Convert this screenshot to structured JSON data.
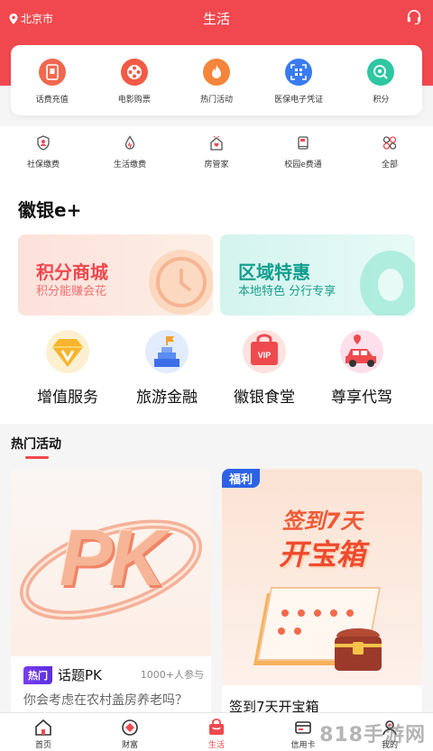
{
  "header": {
    "location": "北京市",
    "title": "生活",
    "support_icon": "headset-icon"
  },
  "services": [
    {
      "label": "话费充值",
      "icon": "phone-icon",
      "color": "#f0684e"
    },
    {
      "label": "电影购票",
      "icon": "film-reel-icon",
      "color": "#f25a45"
    },
    {
      "label": "热门活动",
      "icon": "flame-icon",
      "color": "#f4853a"
    },
    {
      "label": "医保电子凭证",
      "icon": "qr-scan-icon",
      "color": "#3a7bf2"
    },
    {
      "label": "积分",
      "icon": "points-icon",
      "color": "#2fc7a2"
    }
  ],
  "quick": [
    {
      "label": "社保缴费",
      "icon": "shield-person-icon"
    },
    {
      "label": "生活缴费",
      "icon": "drop-icon"
    },
    {
      "label": "房管家",
      "icon": "house-heart-icon"
    },
    {
      "label": "校园e费通",
      "icon": "book-icon"
    },
    {
      "label": "全部",
      "icon": "grid-icon"
    }
  ],
  "section_title": "徽银e+",
  "promos": [
    {
      "title": "积分商城",
      "subtitle": "积分能赚会花",
      "title_color": "#f0484e",
      "sub_color": "#f07070",
      "bg_from": "#fde1db",
      "bg_to": "#fcefe5"
    },
    {
      "title": "区域特惠",
      "subtitle": "本地特色 分行专享",
      "title_color": "#0f9e8e",
      "sub_color": "#1a9e8e",
      "bg_from": "#d4f4ee",
      "bg_to": "#e7faf6"
    }
  ],
  "features": [
    {
      "label": "增值服务",
      "icon": "diamond-v-icon"
    },
    {
      "label": "旅游金融",
      "icon": "flag-tower-icon"
    },
    {
      "label": "徽银食堂",
      "icon": "vip-bag-icon"
    },
    {
      "label": "尊享代驾",
      "icon": "red-car-icon"
    }
  ],
  "hot": {
    "title": "热门活动",
    "left": {
      "art_text": "PK",
      "badge": "热门",
      "title": "话题PK",
      "count": "1000+人参与",
      "question": "你会考虑在农村盖房养老吗？"
    },
    "right": {
      "tag": "福利",
      "art_line1": "签到7天",
      "art_line2": "开宝箱",
      "title": "签到7天开宝箱"
    }
  },
  "tabs": [
    {
      "label": "首页",
      "icon": "home-icon",
      "active": false
    },
    {
      "label": "财富",
      "icon": "wealth-icon",
      "active": false
    },
    {
      "label": "生活",
      "icon": "shopping-bag-icon",
      "active": true
    },
    {
      "label": "信用卡",
      "icon": "credit-card-icon",
      "active": false
    },
    {
      "label": "我的",
      "icon": "user-icon",
      "active": false
    }
  ],
  "watermark": "818手游网",
  "colors": {
    "brand": "#f0484e"
  }
}
